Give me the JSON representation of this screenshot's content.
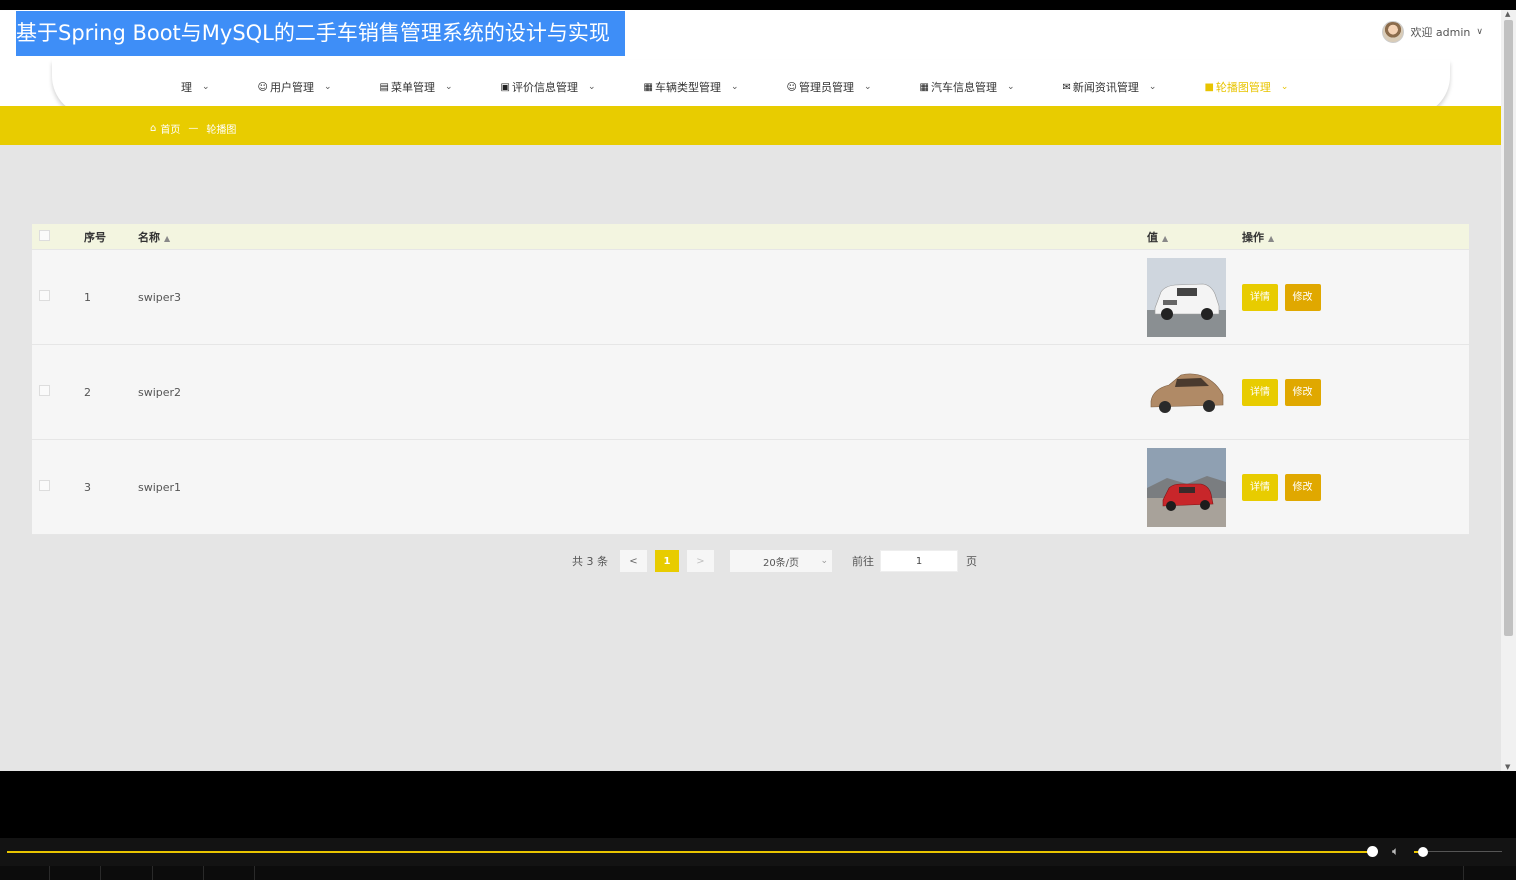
{
  "header": {
    "title": "基于Spring Boot与MySQL的二手车销售管理系统的设计与实现",
    "welcome": "欢迎 admin",
    "user_chevron": "∨"
  },
  "nav": {
    "items": [
      {
        "icon": "",
        "label": "理"
      },
      {
        "icon": "user-icon",
        "label": "用户管理"
      },
      {
        "icon": "menu-icon",
        "label": "菜单管理"
      },
      {
        "icon": "rating-icon",
        "label": "评价信息管理"
      },
      {
        "icon": "grid-icon",
        "label": "车辆类型管理"
      },
      {
        "icon": "admin-icon",
        "label": "管理员管理"
      },
      {
        "icon": "grid-icon",
        "label": "汽车信息管理"
      },
      {
        "icon": "news-icon",
        "label": "新闻资讯管理"
      },
      {
        "icon": "carousel-icon",
        "label": "轮播图管理",
        "active": true
      }
    ]
  },
  "breadcrumb": {
    "home": "首页",
    "separator": "—",
    "current": "轮播图"
  },
  "table": {
    "headers": {
      "index": "序号",
      "name": "名称",
      "value": "值",
      "actions": "操作"
    },
    "rows": [
      {
        "index": "1",
        "name": "swiper3",
        "image": "white-suv"
      },
      {
        "index": "2",
        "name": "swiper2",
        "image": "bronze-sedan"
      },
      {
        "index": "3",
        "name": "swiper1",
        "image": "red-suv"
      }
    ],
    "detail_label": "详情",
    "edit_label": "修改"
  },
  "pagination": {
    "total": "共 3 条",
    "prev": "<",
    "current": "1",
    "next": ">",
    "page_size": "20条/页",
    "goto_label": "前往",
    "goto_value": "1",
    "page_suffix": "页"
  },
  "colors": {
    "accent": "#e8cc00",
    "title_bg": "#3e8ef7",
    "edit_button": "#e0a800"
  },
  "player": {
    "progress": 0.996,
    "volume": 0.1
  }
}
